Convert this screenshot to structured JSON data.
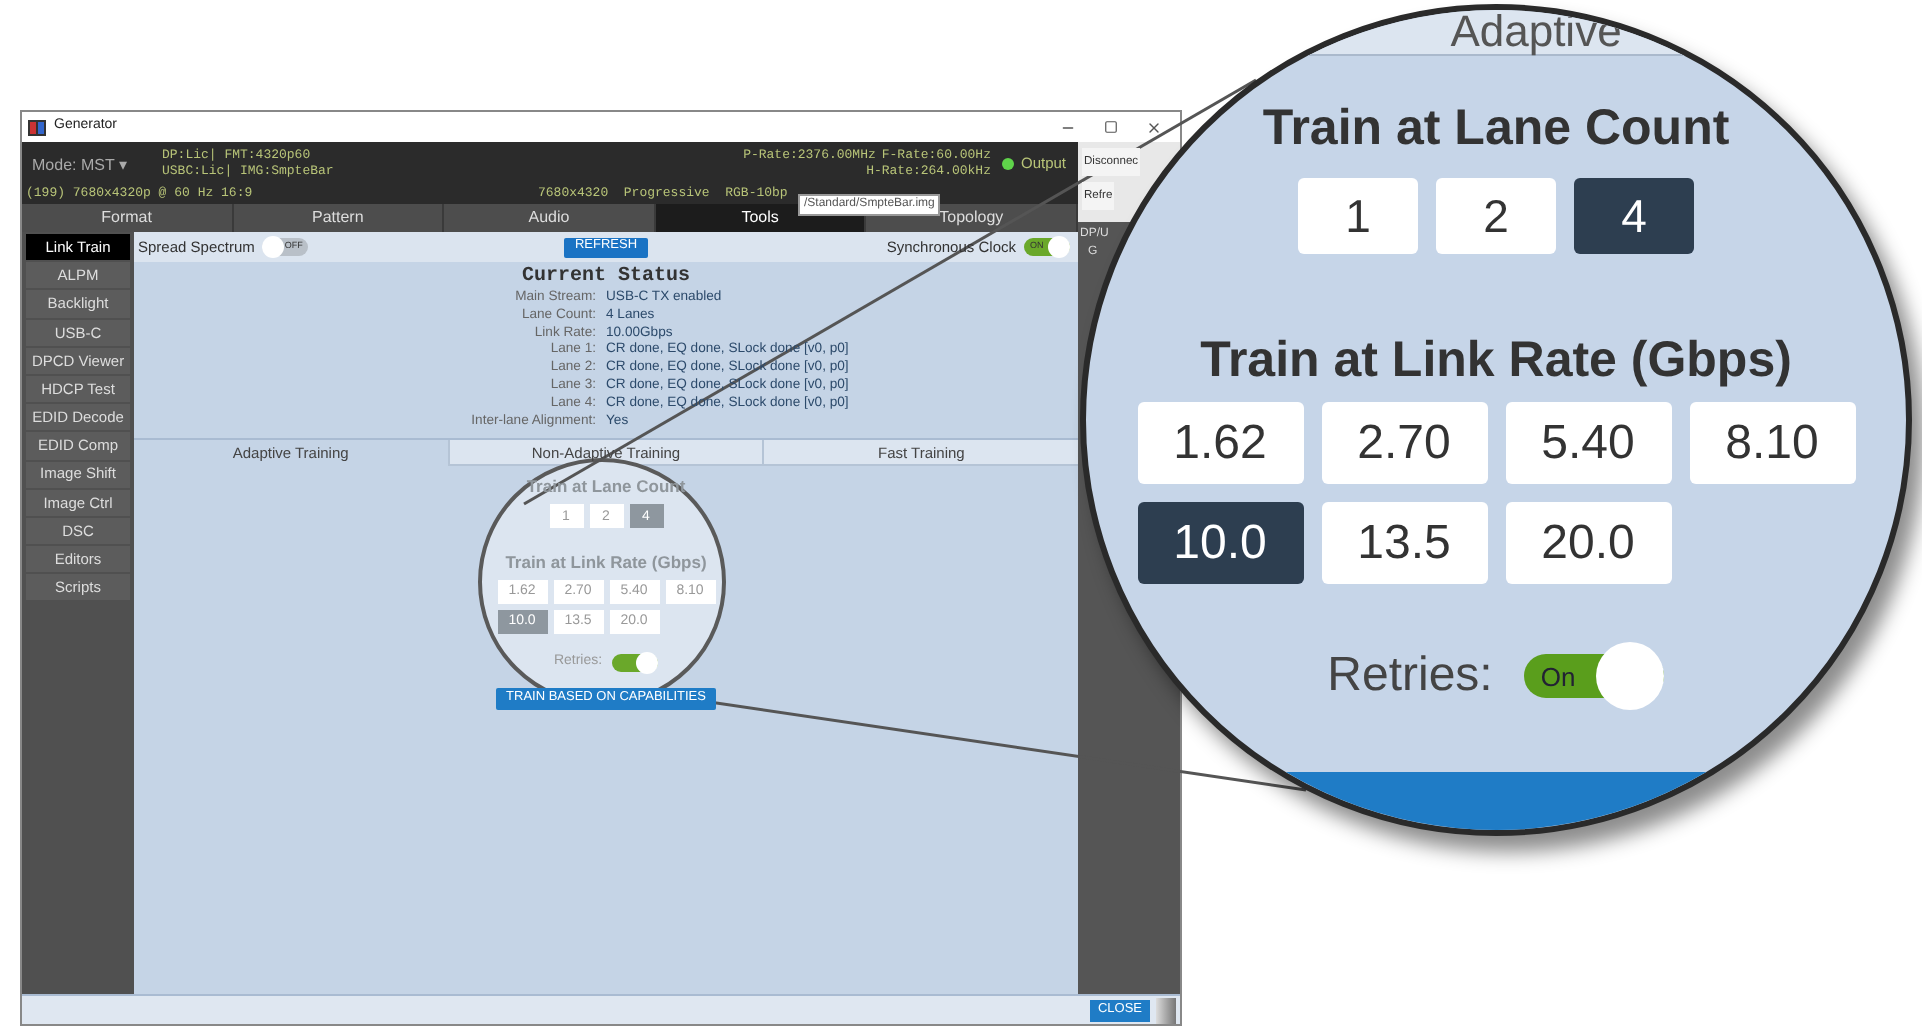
{
  "window": {
    "title": "Generator"
  },
  "header": {
    "mode": "Mode: MST",
    "mode_caret": "▾",
    "status_lines": [
      "DP:Lic| FMT:4320p60",
      "USBC:Lic| IMG:SmpteBar"
    ],
    "timing": "(199) 7680x4320p @ 60 Hz 16:9",
    "format": "7680x4320  Progressive  RGB-10bp",
    "p_rate": "P-Rate:2376.00MHz",
    "f_rate": "F-Rate:60.00Hz",
    "h_rate": "H-Rate:264.00kHz",
    "output": "Output"
  },
  "tabs": [
    {
      "label": "Format",
      "selected": false
    },
    {
      "label": "Pattern",
      "selected": false
    },
    {
      "label": "Audio",
      "selected": false
    },
    {
      "label": "Tools",
      "selected": true
    },
    {
      "label": "Topology",
      "selected": false
    }
  ],
  "tooltip": "/Standard/SmpteBar.img",
  "side_panel": {
    "buttons": [
      "Disconnec",
      "Refre"
    ],
    "lines": [
      "DP/U",
      "G"
    ]
  },
  "sidebar": {
    "items": [
      {
        "label": "Link Train",
        "selected": true
      },
      {
        "label": "ALPM",
        "selected": false
      },
      {
        "label": "Backlight",
        "selected": false
      },
      {
        "label": "USB-C",
        "selected": false
      },
      {
        "label": "DPCD Viewer",
        "selected": false
      },
      {
        "label": "HDCP Test",
        "selected": false
      },
      {
        "label": "EDID Decode",
        "selected": false
      },
      {
        "label": "EDID Comp",
        "selected": false
      },
      {
        "label": "Image Shift",
        "selected": false
      },
      {
        "label": "Image Ctrl",
        "selected": false
      },
      {
        "label": "DSC",
        "selected": false
      },
      {
        "label": "Editors",
        "selected": false
      },
      {
        "label": "Scripts",
        "selected": false
      }
    ]
  },
  "toolbar": {
    "toggles": [
      {
        "label": "Spread Spectrum",
        "on": false,
        "text": "OFF"
      },
      {
        "label": "Synchronous Clock",
        "on": true,
        "text": "ON"
      }
    ],
    "refresh": "REFRESH"
  },
  "status": {
    "title": "Current Status",
    "rows": [
      {
        "label": "Main Stream:",
        "value": "USB-C TX enabled"
      },
      {
        "label": "Lane Count:",
        "value": "4 Lanes"
      },
      {
        "label": "Link Rate:",
        "value": "10.00Gbps"
      },
      {
        "label": "Lane 1:",
        "value": "CR done, EQ done, SLock done [v0, p0]"
      },
      {
        "label": "Lane 2:",
        "value": "CR done, EQ done, SLock done [v0, p0]"
      },
      {
        "label": "Lane 3:",
        "value": "CR done, EQ done, SLock done [v0, p0]"
      },
      {
        "label": "Lane 4:",
        "value": "CR done, EQ done, SLock done [v0, p0]"
      },
      {
        "label": "Inter-lane Alignment:",
        "value": "Yes"
      }
    ]
  },
  "training_tabs": [
    {
      "label": "Adaptive Training",
      "selected": true
    },
    {
      "label": "Non-Adaptive Training",
      "selected": false
    },
    {
      "label": "Fast Training",
      "selected": false
    }
  ],
  "training": {
    "lane_title": "Train at Lane Count",
    "lanes": [
      {
        "label": "1",
        "selected": false
      },
      {
        "label": "2",
        "selected": false
      },
      {
        "label": "4",
        "selected": true
      }
    ],
    "rate_title": "Train at Link Rate (Gbps)",
    "rates": [
      {
        "label": "1.62",
        "selected": false
      },
      {
        "label": "2.70",
        "selected": false
      },
      {
        "label": "5.40",
        "selected": false
      },
      {
        "label": "8.10",
        "selected": false
      },
      {
        "label": "10.0",
        "selected": true
      },
      {
        "label": "13.5",
        "selected": false
      },
      {
        "label": "20.0",
        "selected": false
      }
    ],
    "retries": {
      "label": "Retries:",
      "on": true
    },
    "action": "TRAIN BASED ON CAPABILITIES"
  },
  "footer": {
    "close": "CLOSE"
  },
  "magnifier": {
    "tab_text": "Adaptive",
    "lane_title": "Train at Lane Count",
    "lanes": [
      {
        "label": "1",
        "selected": false
      },
      {
        "label": "2",
        "selected": false
      },
      {
        "label": "4",
        "selected": true
      }
    ],
    "rate_title": "Train at Link Rate (Gbps)",
    "rates": [
      {
        "label": "1.62",
        "selected": false
      },
      {
        "label": "2.70",
        "selected": false
      },
      {
        "label": "5.40",
        "selected": false
      },
      {
        "label": "8.10",
        "selected": false
      },
      {
        "label": "10.0",
        "selected": true
      },
      {
        "label": "13.5",
        "selected": false
      },
      {
        "label": "20.0",
        "selected": false
      }
    ],
    "retries": {
      "label": "Retries:",
      "on": true,
      "text": "On"
    }
  }
}
